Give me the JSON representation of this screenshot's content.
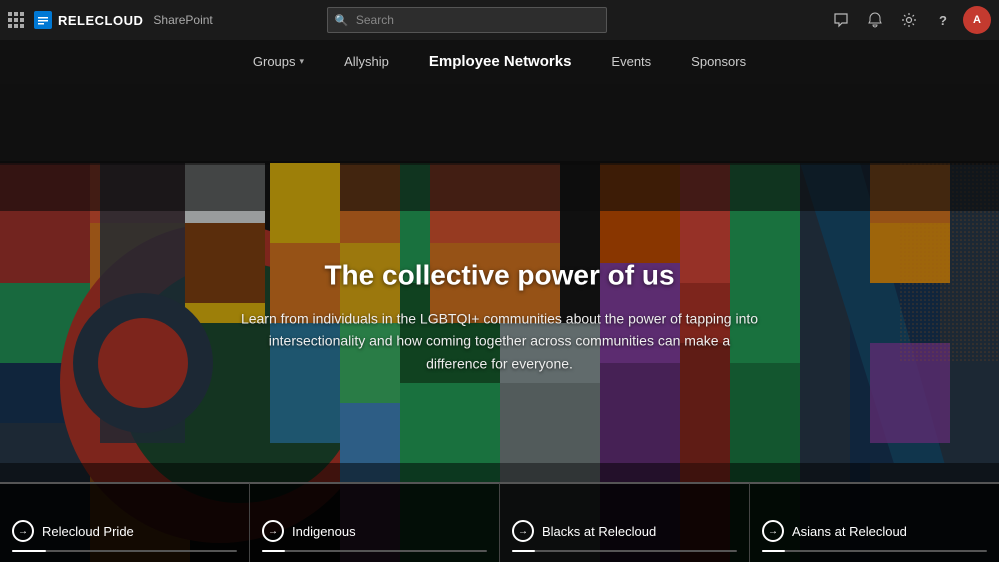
{
  "app": {
    "logo_text": "RELECLOUD",
    "sharepoint_text": "SharePoint"
  },
  "topbar": {
    "search_placeholder": "Search",
    "icons": {
      "speech_bubble": "💬",
      "bell": "🔔",
      "settings": "⚙",
      "question": "?",
      "avatar_initials": "A"
    }
  },
  "nav": {
    "items": [
      {
        "label": "Groups",
        "has_dropdown": true,
        "active": false
      },
      {
        "label": "Allyship",
        "has_dropdown": false,
        "active": false
      },
      {
        "label": "Employee Networks",
        "has_dropdown": false,
        "active": true
      },
      {
        "label": "Events",
        "has_dropdown": false,
        "active": false
      },
      {
        "label": "Sponsors",
        "has_dropdown": false,
        "active": false
      }
    ]
  },
  "hero": {
    "title": "The collective power of us",
    "subtitle": "Learn from individuals in the LGBTQI+ communities about the power of tapping into intersectionality and how coming together across communities can make a difference for everyone."
  },
  "cards": [
    {
      "label": "Relecloud Pride",
      "progress": 15
    },
    {
      "label": "Indigenous",
      "progress": 10
    },
    {
      "label": "Blacks at Relecloud",
      "progress": 10
    },
    {
      "label": "Asians at Relecloud",
      "progress": 10
    }
  ]
}
